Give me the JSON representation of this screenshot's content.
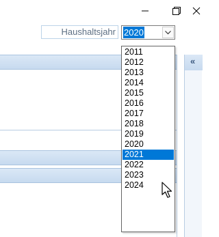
{
  "window": {
    "minimize_icon": "minimize-icon",
    "maximize_icon": "restore-icon",
    "close_icon": "close-icon"
  },
  "filter": {
    "label": "Haushaltsjahr",
    "selected_value": "2020",
    "dropdown_icon": "chevron-down-icon"
  },
  "right_pane": {
    "collapse_label": "«"
  },
  "dropdown": {
    "options": [
      "2011",
      "2012",
      "2013",
      "2014",
      "2015",
      "2016",
      "2017",
      "2018",
      "2019",
      "2020",
      "2021",
      "2022",
      "2023",
      "2024"
    ],
    "highlighted": "2021"
  },
  "colors": {
    "accent": "#0078d7",
    "panel_band": "#c7daef",
    "label_text": "#5d6f83"
  }
}
